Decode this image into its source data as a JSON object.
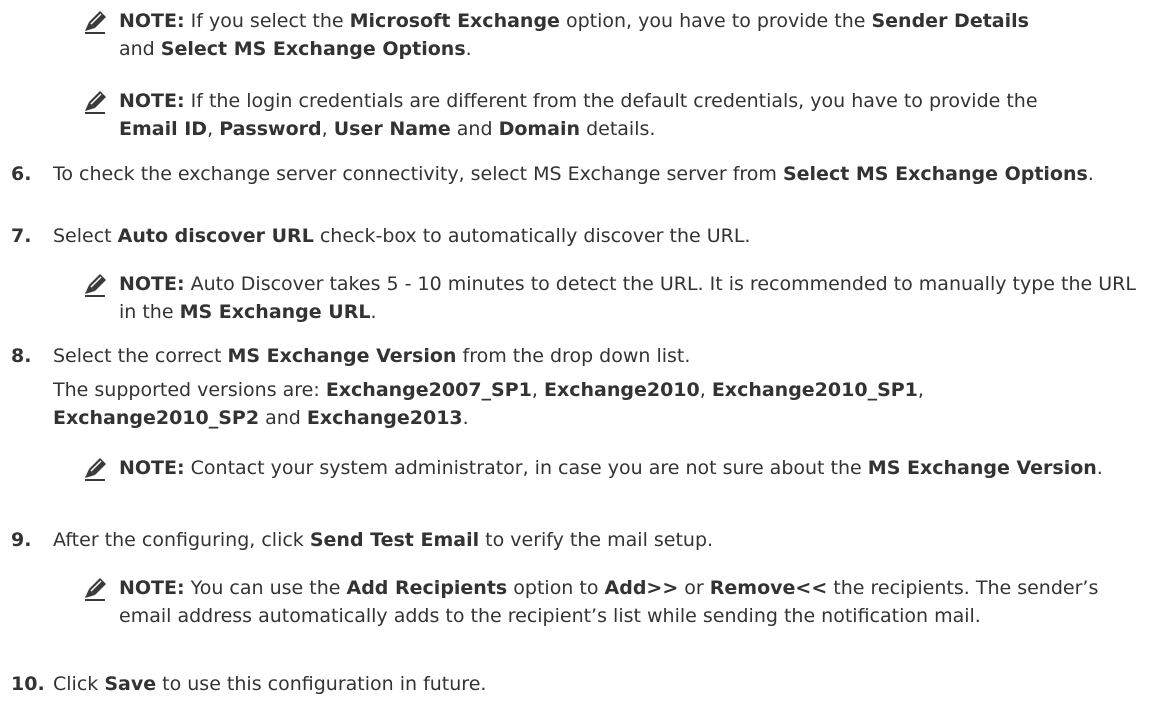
{
  "notes": [
    {
      "label": "NOTE:",
      "parts": [
        "If you select the ",
        "Microsoft Exchange",
        " option, you have to provide the ",
        "Sender Details",
        " and ",
        "Select MS Exchange Options",
        "."
      ]
    },
    {
      "label": "NOTE:",
      "parts": [
        "If the login credentials are different from the default credentials, you have to provide the ",
        "Email ID",
        ", ",
        "Password",
        ", ",
        "User Name",
        " and ",
        "Domain",
        " details."
      ]
    },
    {
      "label": "NOTE:",
      "parts": [
        "Auto Discover takes 5 - 10 minutes to detect the URL. It is recommended to manually type the URL in the ",
        "MS Exchange URL",
        "."
      ]
    },
    {
      "label": "NOTE:",
      "parts": [
        "Contact your system administrator, in case you are not sure about the ",
        "MS Exchange Version",
        "."
      ]
    },
    {
      "label": "NOTE:",
      "parts": [
        "You can use the ",
        "Add Recipients",
        " option  to ",
        "Add>>",
        " or ",
        "Remove<<",
        "  the recipients. The sender’s email address automatically adds to the recipient’s list while sending the notification mail."
      ]
    }
  ],
  "steps": [
    {
      "number": "6.",
      "parts": [
        "To check the exchange server connectivity, select MS Exchange server from ",
        "Select MS Exchange Options",
        "."
      ]
    },
    {
      "number": "7.",
      "parts": [
        "Select ",
        "Auto discover URL",
        " check-box to automatically discover the URL."
      ]
    },
    {
      "number": "8.",
      "parts": [
        "Select the correct ",
        "MS Exchange Version",
        " from the drop down list."
      ],
      "extra_parts": [
        "The supported versions are: ",
        "Exchange2007_SP1",
        ", ",
        "Exchange2010",
        ", ",
        "Exchange2010_SP1",
        ", ",
        "Exchange2010_SP2",
        " and ",
        "Exchange2013",
        "."
      ]
    },
    {
      "number": "9.",
      "parts": [
        "After the configuring, click ",
        "Send Test Email",
        " to verify the mail setup."
      ]
    },
    {
      "number": "10.",
      "parts": [
        "Click ",
        "Save",
        " to use this configuration in future."
      ]
    }
  ],
  "icon": "note-pencil-icon",
  "colors": {
    "text": "#333333",
    "icon": "#3a3a3a"
  }
}
